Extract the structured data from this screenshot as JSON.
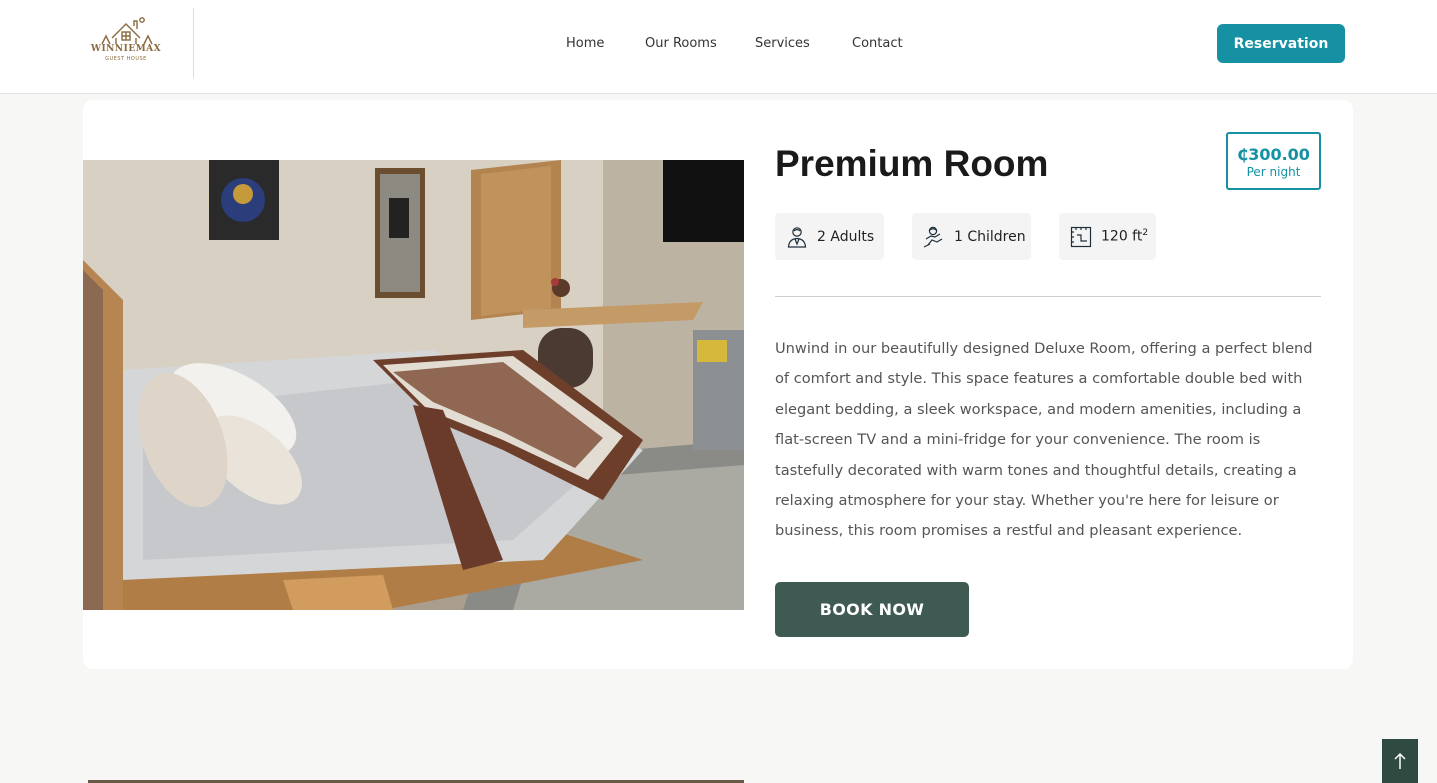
{
  "header": {
    "logo": {
      "name": "WINNIEMAX",
      "subtitle": "GUEST HOUSE"
    },
    "nav": [
      {
        "label": "Home"
      },
      {
        "label": "Our Rooms"
      },
      {
        "label": "Services"
      },
      {
        "label": "Contact"
      }
    ],
    "reservation_label": "Reservation"
  },
  "room": {
    "title": "Premium Room",
    "price": {
      "amount": "₵300.00",
      "unit": "Per night"
    },
    "features": [
      {
        "icon": "adult-person-icon",
        "label": "2 Adults"
      },
      {
        "icon": "child-person-icon",
        "label": "1 Children"
      },
      {
        "icon": "room-size-icon",
        "label": "120 ft",
        "sup": "2"
      }
    ],
    "description": "Unwind in our beautifully designed Deluxe Room, offering a perfect blend of comfort and style. This space features a comfortable double bed with elegant bedding, a sleek workspace, and modern amenities, including a flat-screen TV and a mini-fridge for your convenience. The room is tastefully decorated with warm tones and thoughtful details, creating a relaxing atmosphere for your stay. Whether you're here for leisure or business, this room promises a restful and pleasant experience.",
    "book_label": "BOOK NOW",
    "photo": "room-photo-bed"
  },
  "colors": {
    "accent": "#1591a3",
    "book_button": "#3f5a53",
    "scroll_top": "#2f4a40",
    "logo_gold": "#8a6a3e"
  }
}
